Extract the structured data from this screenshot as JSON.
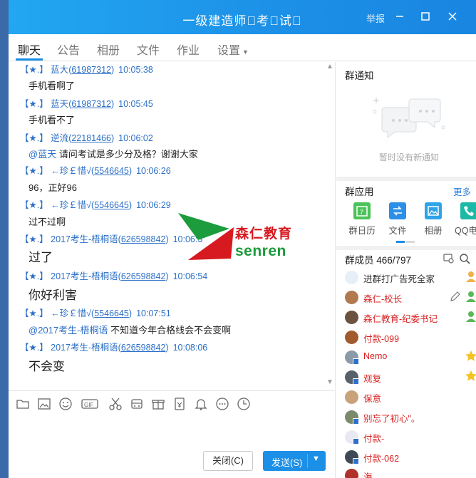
{
  "window": {
    "title": "一级建造师\u0000考\u0000试\u0000",
    "report": "举报"
  },
  "tabs": [
    {
      "label": "聊天"
    },
    {
      "label": "公告"
    },
    {
      "label": "相册"
    },
    {
      "label": "文件"
    },
    {
      "label": "作业"
    },
    {
      "label": "设置"
    }
  ],
  "messages": [
    {
      "tag": "【★.】",
      "name": "蓝大",
      "id": "61987312",
      "time": "10:05:38",
      "text": "手机看啊了",
      "at": ""
    },
    {
      "tag": "【★.】",
      "name": "蓝天",
      "id": "61987312",
      "time": "10:05:45",
      "text": "手机看不了",
      "at": ""
    },
    {
      "tag": "【★.】",
      "name": "逆流",
      "id": "22181466",
      "time": "10:06:02",
      "text": "请问考试是多少分及格？谢谢大家",
      "at": "@蓝天"
    },
    {
      "tag": "【★.】",
      "name": "←珍￡惜√",
      "id": "5546645",
      "time": "10:06:26",
      "text": "96，正好96",
      "at": ""
    },
    {
      "tag": "【★.】",
      "name": "←珍￡惜√",
      "id": "5546645",
      "time": "10:06:29",
      "text": "过不过啊",
      "at": ""
    },
    {
      "tag": "【★.】",
      "name": "2017考生-梧桐语",
      "id": "626598842",
      "time": "10:06:3",
      "text": "过了",
      "at": ""
    },
    {
      "tag": "【★.】",
      "name": "2017考生-梧桐语",
      "id": "626598842",
      "time": "10:06:54",
      "text": "你好利害",
      "at": ""
    },
    {
      "tag": "【★.】",
      "name": "←珍￡惜√",
      "id": "5546645",
      "time": "10:07:51",
      "text": "不知道今年合格线会不会变啊",
      "at": "@2017考生-梧桐语"
    },
    {
      "tag": "【★.】",
      "name": "2017考生-梧桐语",
      "id": "626598842",
      "time": "10:08:06",
      "text": "不会变",
      "at": ""
    }
  ],
  "watermark": {
    "cn": "森仁教育",
    "en": "senren"
  },
  "buttons": {
    "close": "关闭(C)",
    "send": "发送(S)"
  },
  "sidebar": {
    "notice_title": "群通知",
    "notice_empty": "暂时没有新通知",
    "apps_title": "群应用",
    "more": "更多",
    "apps": [
      {
        "label": "群日历",
        "color": "#4cc35a"
      },
      {
        "label": "文件",
        "color": "#2d8fe6"
      },
      {
        "label": "相册",
        "color": "#2fa3e8"
      },
      {
        "label": "QQ电话",
        "color": "#1cb9a6"
      }
    ],
    "members_title": "群成员 466/797",
    "members": [
      {
        "name": "进群打广告死全家",
        "color": "#333333"
      },
      {
        "name": "森仁-校长",
        "color": "#d81e1e"
      },
      {
        "name": "森仁教育-纪委书记",
        "color": "#d81e1e"
      },
      {
        "name": "付款-099",
        "color": "#d81e1e"
      },
      {
        "name": "Nemo",
        "color": "#d81e1e"
      },
      {
        "name": "观复",
        "color": "#d81e1e"
      },
      {
        "name": "保意",
        "color": "#d81e1e"
      },
      {
        "name": "别忘了初心\"。",
        "color": "#d81e1e"
      },
      {
        "name": "付款-",
        "color": "#d81e1e"
      },
      {
        "name": "付款-062",
        "color": "#d81e1e"
      },
      {
        "name": "海",
        "color": "#d81e1e"
      }
    ]
  }
}
